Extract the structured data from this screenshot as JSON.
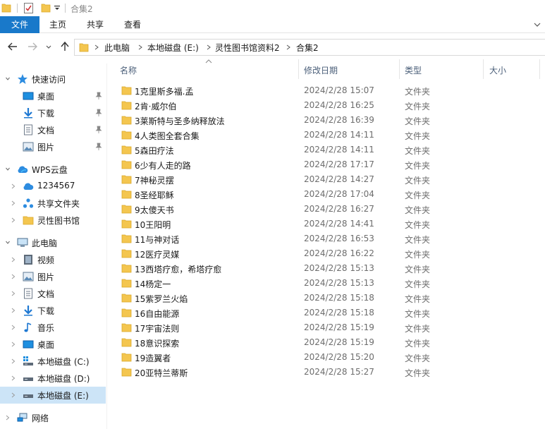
{
  "window": {
    "title": "合集2"
  },
  "ribbon": {
    "tabs": [
      "文件",
      "主页",
      "共享",
      "查看"
    ]
  },
  "address": {
    "segments": [
      "此电脑",
      "本地磁盘 (E:)",
      "灵性图书馆资料2",
      "合集2"
    ]
  },
  "sidebar": {
    "items": [
      {
        "label": "快速访问",
        "icon": "star-icon",
        "pinned": false
      },
      {
        "label": "桌面",
        "icon": "desktop-icon",
        "pinned": true
      },
      {
        "label": "下载",
        "icon": "download-icon",
        "pinned": true
      },
      {
        "label": "文档",
        "icon": "document-icon",
        "pinned": true
      },
      {
        "label": "图片",
        "icon": "picture-icon",
        "pinned": true
      },
      {
        "label": "WPS云盘",
        "icon": "wps-cloud-icon",
        "pinned": false
      },
      {
        "label": "1234567",
        "icon": "cloud-icon",
        "pinned": false
      },
      {
        "label": "共享文件夹",
        "icon": "share-icon",
        "pinned": false
      },
      {
        "label": "灵性图书馆",
        "icon": "folder-icon",
        "pinned": false
      },
      {
        "label": "此电脑",
        "icon": "pc-icon",
        "pinned": false
      },
      {
        "label": "视频",
        "icon": "video-icon",
        "pinned": false
      },
      {
        "label": "图片",
        "icon": "picture-icon",
        "pinned": false
      },
      {
        "label": "文档",
        "icon": "document-icon",
        "pinned": false
      },
      {
        "label": "下载",
        "icon": "download-icon",
        "pinned": false
      },
      {
        "label": "音乐",
        "icon": "music-icon",
        "pinned": false
      },
      {
        "label": "桌面",
        "icon": "desktop-icon",
        "pinned": false
      },
      {
        "label": "本地磁盘 (C:)",
        "icon": "drive-c-icon",
        "pinned": false
      },
      {
        "label": "本地磁盘 (D:)",
        "icon": "drive-icon",
        "pinned": false
      },
      {
        "label": "本地磁盘 (E:)",
        "icon": "drive-icon",
        "pinned": false
      },
      {
        "label": "网络",
        "icon": "network-icon",
        "pinned": false
      }
    ]
  },
  "list": {
    "columns": [
      "名称",
      "修改日期",
      "类型",
      "大小"
    ],
    "rows": [
      {
        "name": "1克里斯多福.孟",
        "date": "2024/2/28 15:07",
        "type": "文件夹"
      },
      {
        "name": "2肯·威尔伯",
        "date": "2024/2/28 16:25",
        "type": "文件夹"
      },
      {
        "name": "3莱斯特与圣多纳释放法",
        "date": "2024/2/28 16:39",
        "type": "文件夹"
      },
      {
        "name": "4人类图全套合集",
        "date": "2024/2/28 14:11",
        "type": "文件夹"
      },
      {
        "name": "5森田疗法",
        "date": "2024/2/28 14:11",
        "type": "文件夹"
      },
      {
        "name": "6少有人走的路",
        "date": "2024/2/28 17:17",
        "type": "文件夹"
      },
      {
        "name": "7神秘灵摆",
        "date": "2024/2/28 14:27",
        "type": "文件夹"
      },
      {
        "name": "8圣经耶稣",
        "date": "2024/2/28 17:04",
        "type": "文件夹"
      },
      {
        "name": "9太傻天书",
        "date": "2024/2/28 16:27",
        "type": "文件夹"
      },
      {
        "name": "10王阳明",
        "date": "2024/2/28 14:41",
        "type": "文件夹"
      },
      {
        "name": "11与神对话",
        "date": "2024/2/28 16:53",
        "type": "文件夹"
      },
      {
        "name": "12医疗灵媒",
        "date": "2024/2/28 16:22",
        "type": "文件夹"
      },
      {
        "name": "13西塔疗愈，希塔疗愈",
        "date": "2024/2/28 15:13",
        "type": "文件夹"
      },
      {
        "name": "14杨定一",
        "date": "2024/2/28 15:13",
        "type": "文件夹"
      },
      {
        "name": "15紫罗兰火焰",
        "date": "2024/2/28 15:18",
        "type": "文件夹"
      },
      {
        "name": "16自由能源",
        "date": "2024/2/28 15:18",
        "type": "文件夹"
      },
      {
        "name": "17宇宙法则",
        "date": "2024/2/28 15:19",
        "type": "文件夹"
      },
      {
        "name": "18意识探索",
        "date": "2024/2/28 15:19",
        "type": "文件夹"
      },
      {
        "name": "19造翼者",
        "date": "2024/2/28 15:20",
        "type": "文件夹"
      },
      {
        "name": "20亚特兰蒂斯",
        "date": "2024/2/28 15:27",
        "type": "文件夹"
      }
    ]
  },
  "colors": {
    "accent": "#1979ca",
    "folder": "#f4c64f",
    "selected": "#cce4f7"
  }
}
